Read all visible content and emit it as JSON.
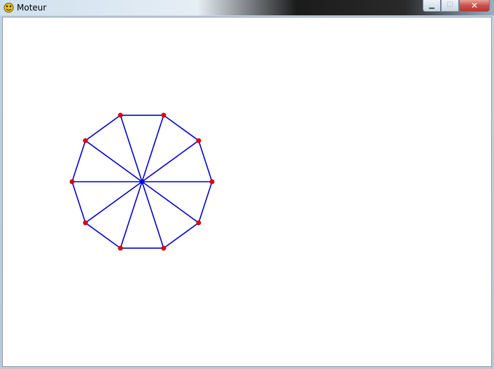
{
  "window": {
    "title": "Moteur",
    "app_icon": "pygame-snake-icon",
    "controls": {
      "minimize_icon": "minimize-icon",
      "maximize_icon": "maximize-icon",
      "close_icon": "close-icon"
    }
  },
  "scene": {
    "shape": "decagon-wheel",
    "vertex_count": 10,
    "colors": {
      "edge": "#0000cc",
      "vertex": "#dd0000",
      "hub": "#0000ff",
      "background": "#ffffff"
    }
  }
}
